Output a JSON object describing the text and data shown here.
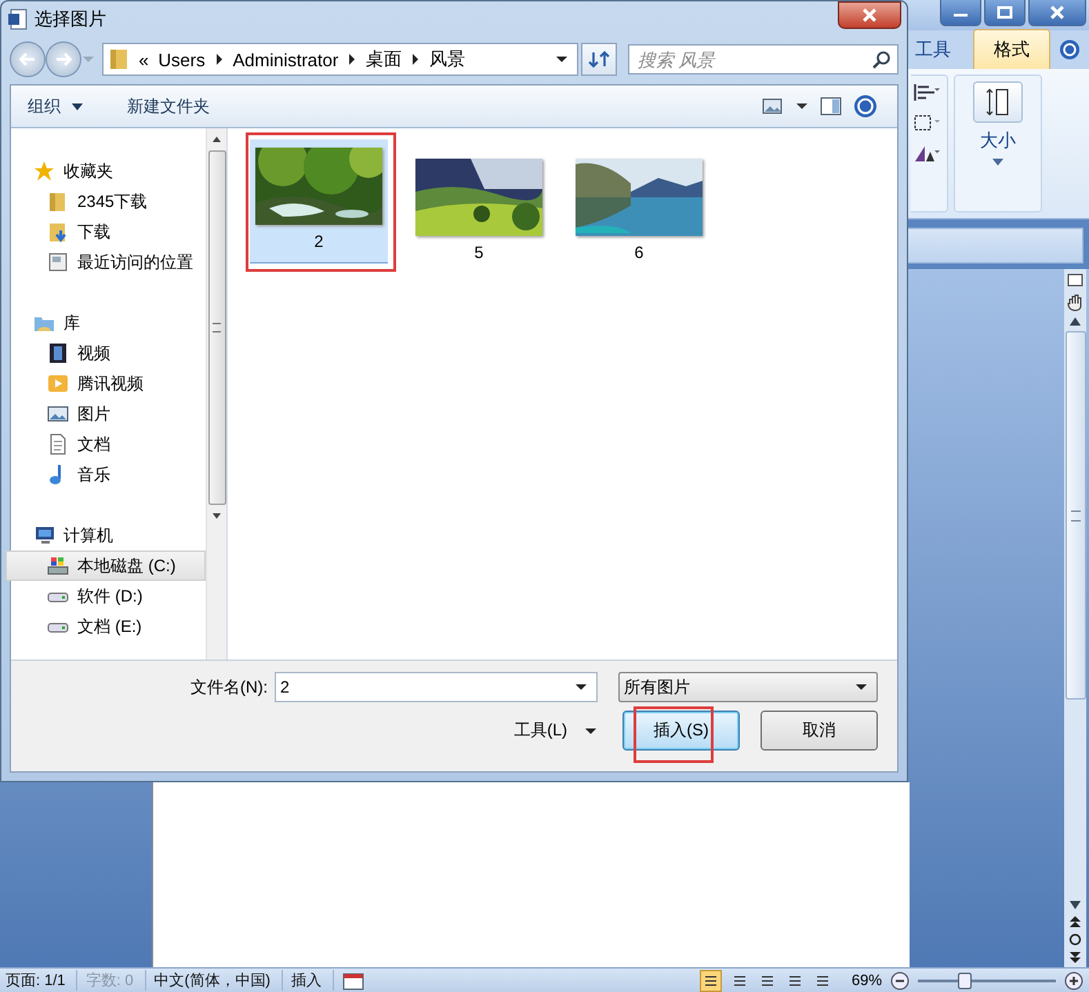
{
  "word": {
    "tabs": [
      {
        "label": "工具",
        "selected": false
      },
      {
        "label": "格式",
        "selected": true
      }
    ],
    "ribbon_group": "大小",
    "status_bar": {
      "items": [
        {
          "text": "页面: 1/1",
          "disabled": false
        },
        {
          "text": "字数: 0",
          "disabled": true
        },
        {
          "text": "中文(简体，中国)",
          "disabled": false
        },
        {
          "text": "插入",
          "disabled": false
        }
      ],
      "views": [
        {
          "selected": true
        },
        {
          "selected": false
        },
        {
          "selected": false
        },
        {
          "selected": false
        },
        {
          "selected": false
        }
      ],
      "zoom": "69%",
      "zoom_slider": {
        "level": 0.33
      }
    }
  },
  "dialog": {
    "title": "选择图片",
    "overflow_mark": "«",
    "breadcrumb": [
      "Users",
      "Administrator",
      "桌面",
      "风景"
    ],
    "search": {
      "placeholder": "搜索 风景"
    },
    "organize": "组织",
    "new_folder": "新建文件夹",
    "sidebar": [
      {
        "label": "收藏夹",
        "kind": "star",
        "selected": false,
        "children": [
          {
            "label": "2345下载",
            "kind": "folder",
            "selected": false
          },
          {
            "label": "下载",
            "kind": "download",
            "selected": false
          },
          {
            "label": "最近访问的位置",
            "kind": "recent",
            "selected": false
          }
        ]
      },
      {
        "label": "库",
        "kind": "library",
        "selected": false,
        "children": [
          {
            "label": "视频",
            "kind": "video",
            "selected": false
          },
          {
            "label": "腾讯视频",
            "kind": "player",
            "selected": false
          },
          {
            "label": "图片",
            "kind": "picture",
            "selected": false
          },
          {
            "label": "文档",
            "kind": "document",
            "selected": false
          },
          {
            "label": "音乐",
            "kind": "music",
            "selected": false
          }
        ]
      },
      {
        "label": "计算机",
        "kind": "computer",
        "selected": false,
        "children": [
          {
            "label": "本地磁盘 (C:)",
            "kind": "system",
            "selected": true
          },
          {
            "label": "软件 (D:)",
            "kind": "drive",
            "selected": false
          },
          {
            "label": "文档 (E:)",
            "kind": "drive",
            "selected": false
          }
        ]
      }
    ],
    "files": [
      {
        "name": "2",
        "selected": true,
        "marked": true
      },
      {
        "name": "5",
        "selected": false,
        "marked": false
      },
      {
        "name": "6",
        "selected": false,
        "marked": false
      }
    ],
    "filename": {
      "label": "文件名(N):",
      "value": "2"
    },
    "file_type": "所有图片",
    "tools": "工具(L)",
    "buttons": [
      {
        "label": "插入(S)",
        "kind": "default",
        "marked": true
      },
      {
        "label": "取消",
        "kind": "normal",
        "marked": false
      }
    ]
  }
}
